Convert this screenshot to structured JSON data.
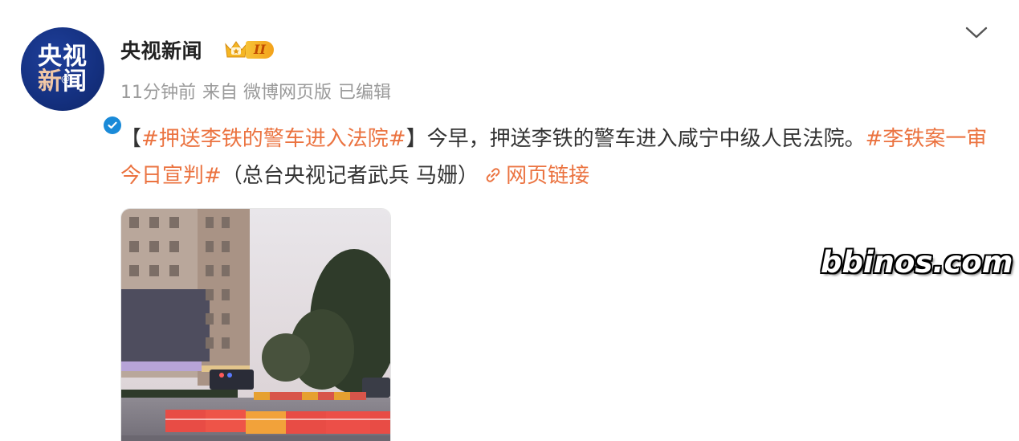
{
  "avatar": {
    "line1": "央视",
    "line2_first": "新",
    "line2_rest": "闻",
    "at_symbol": "@"
  },
  "header": {
    "username": "央视新闻",
    "level_label": "II",
    "time": "11分钟前",
    "source": "来自 微博网页版",
    "edited": "已编辑"
  },
  "content": {
    "bracket_open": "【",
    "hashtag1": "#押送李铁的警车进入法院#",
    "bracket_close": "】",
    "text1": "今早，押送李铁的警车进入咸宁中级人民法院。",
    "hashtag2": "#李铁案一审今日宣判#",
    "text2": "（总台央视记者武兵 马姗）",
    "link_label": "网页链接"
  },
  "watermark": "bbinos.com",
  "colors": {
    "accent": "#eb7340",
    "avatar_bg": "#14307f",
    "verified_blue": "#1a8ad8",
    "meta_gray": "#9a9a9a"
  },
  "icons": {
    "menu": "chevron-down-icon",
    "verified": "verified-check-icon",
    "level": "crown-icon",
    "link": "link-icon"
  }
}
